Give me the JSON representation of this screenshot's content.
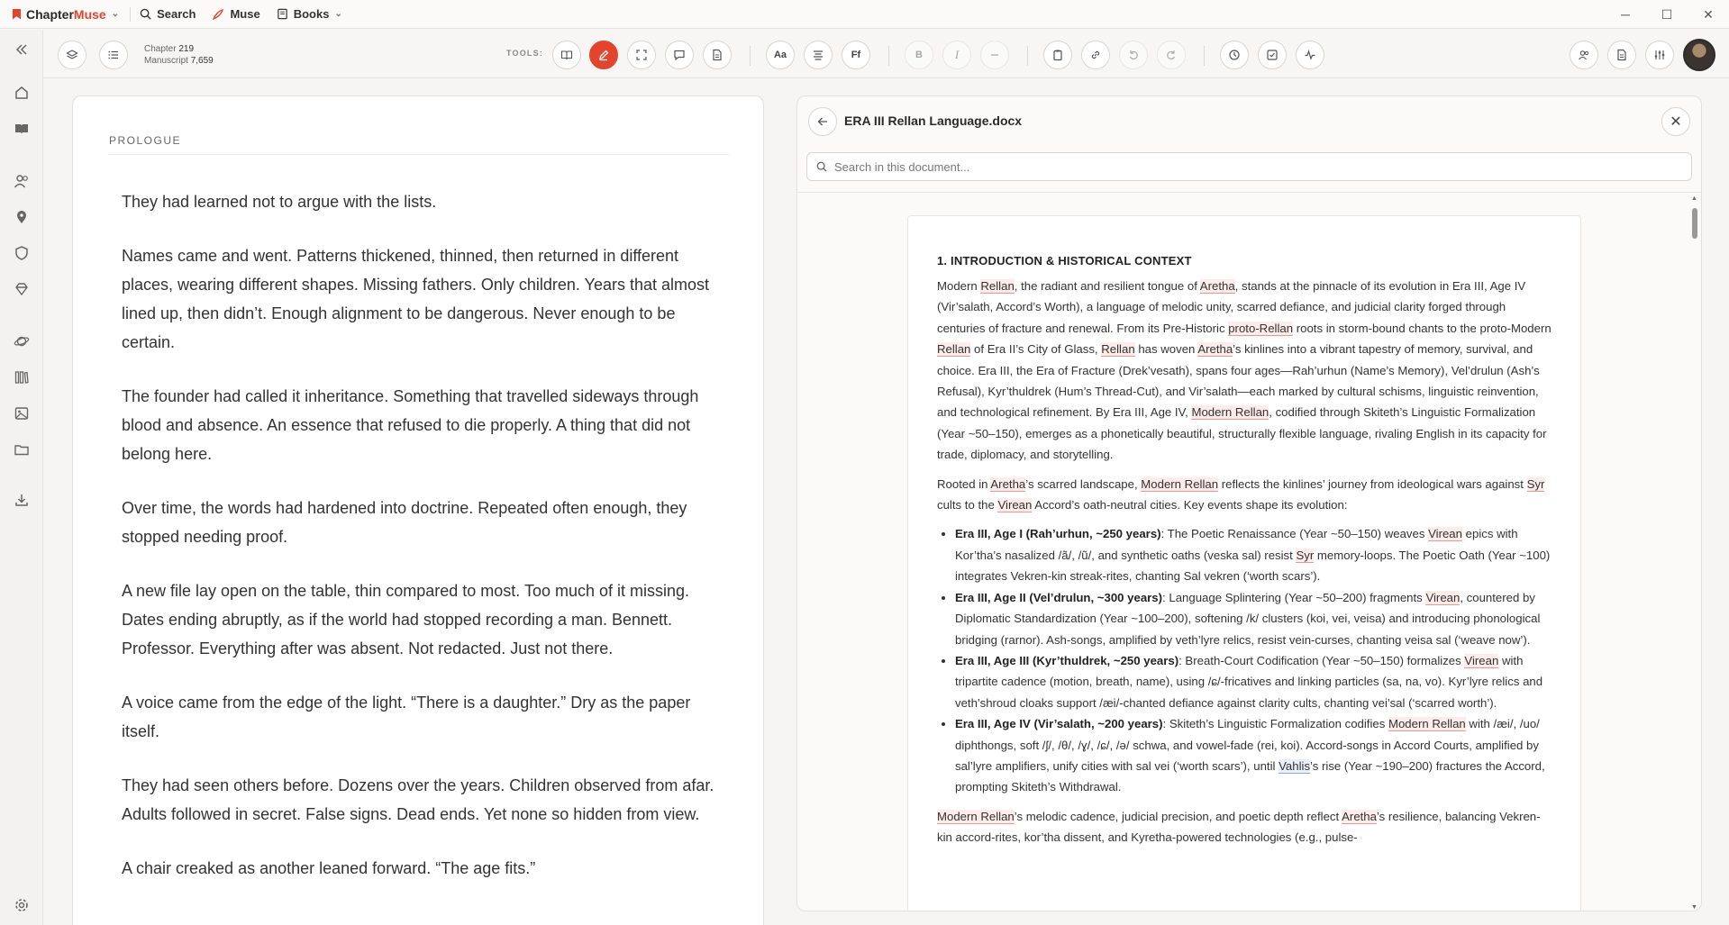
{
  "titlebar": {
    "brand_a": "Chapter",
    "brand_b": "Muse",
    "search": "Search",
    "muse": "Muse",
    "books": "Books"
  },
  "toolbar": {
    "chapter_label": "Chapter",
    "chapter_value": "219",
    "manuscript_label": "Manuscript",
    "manuscript_value": "7,659",
    "tools_label": "TOOLS:",
    "font_size_btn": "Aa",
    "font_family_btn": "Ff",
    "bold_btn": "B",
    "italic_btn": "I"
  },
  "manuscript": {
    "heading": "PROLOGUE",
    "paragraphs": [
      "They had learned not to argue with the lists.",
      "Names came and went. Patterns thickened, thinned, then returned in different places, wearing different shapes. Missing fathers. Only children. Years that almost lined up, then didn’t. Enough alignment to be dangerous. Never enough to be certain.",
      "The founder had called it inheritance. Something that travelled sideways through blood and absence. An essence that refused to die properly. A thing that did not belong here.",
      "Over time, the words had hardened into doctrine. Repeated often enough, they stopped needing proof.",
      "A new file lay open on the table, thin compared to most. Too much of it missing. Dates ending abruptly, as if the world had stopped recording a man. Bennett. Professor. Everything after was absent. Not redacted. Just not there.",
      "A voice came from the edge of the light. “There is a daughter.” Dry as the paper itself.",
      "They had seen others before. Dozens over the years. Children observed from afar. Adults followed in secret. False signs. Dead ends. Yet none so hidden from view.",
      "A chair creaked as another leaned forward. “The age fits.”"
    ]
  },
  "document": {
    "title": "ERA III Rellan Language.docx",
    "search_placeholder": "Search in this document...",
    "section_heading": "1. INTRODUCTION & HISTORICAL CONTEXT"
  }
}
